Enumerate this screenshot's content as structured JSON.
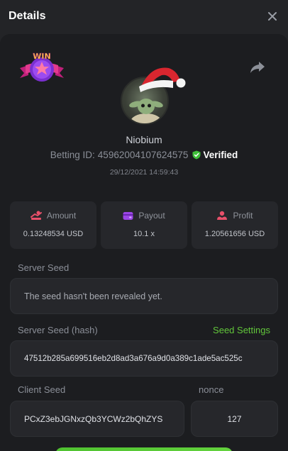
{
  "header": {
    "title": "Details",
    "close_icon": "close-icon"
  },
  "badge": {
    "text": "WIN",
    "icon": "win-badge-icon"
  },
  "share_icon": "share-icon",
  "user": {
    "name": "Niobium",
    "avatar_icon": "avatar-santa-hat"
  },
  "bet": {
    "id_label": "Betting ID:",
    "id_value": "45962004107624575",
    "verified_label": "Verified",
    "date": "29/12/2021 14:59:43"
  },
  "stats": [
    {
      "label": "Amount",
      "value": "0.13248534 USD",
      "icon": "amount-icon",
      "color": "#e8506a"
    },
    {
      "label": "Payout",
      "value": "10.1 x",
      "icon": "payout-icon",
      "color": "#9b45e6"
    },
    {
      "label": "Profit",
      "value": "1.20561656 USD",
      "icon": "profit-icon",
      "color": "#e8506a"
    }
  ],
  "server_seed": {
    "label": "Server Seed",
    "value": "The seed hasn't been revealed yet."
  },
  "server_seed_hash": {
    "label": "Server Seed (hash)",
    "settings_link": "Seed Settings",
    "value": "47512b285a699516eb2d8ad3a676a9d0a389c1ade5ac525c"
  },
  "client_seed": {
    "label": "Client Seed",
    "value": "PCxZ3ebJGNxzQb3YCWz2bQhZYS"
  },
  "nonce": {
    "label": "nonce",
    "value": "127"
  },
  "colors": {
    "accent": "#62c73b",
    "panel": "#1c1d20",
    "card": "#26272b"
  }
}
